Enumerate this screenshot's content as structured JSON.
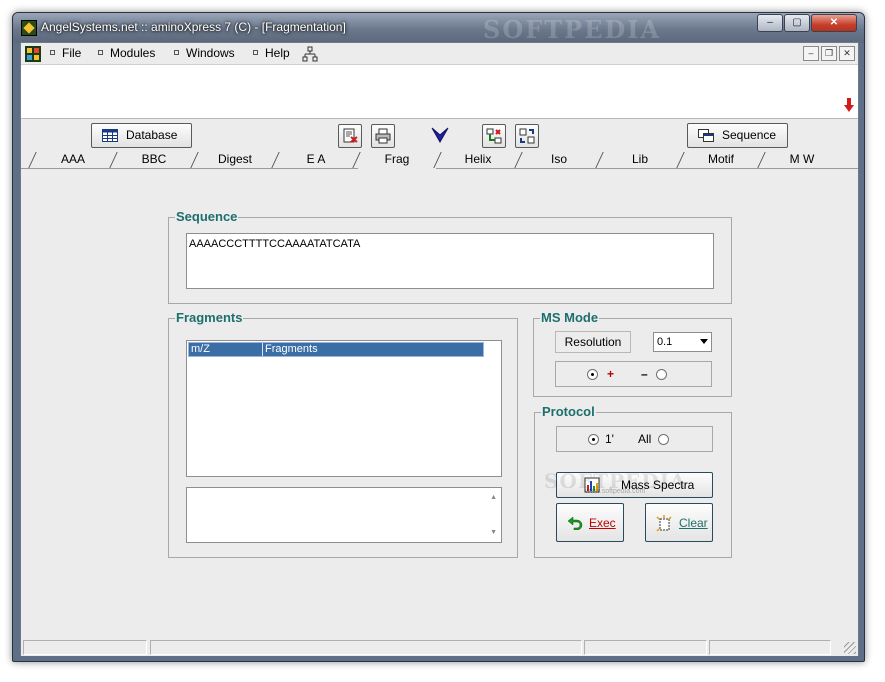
{
  "window": {
    "title": "AngelSystems.net :: aminoXpress 7 (C) - [Fragmentation]",
    "watermark": "SOFTPEDIA",
    "caption_buttons": {
      "minimize": "–",
      "maximize": "▢",
      "close": "✕"
    }
  },
  "menu": {
    "items": [
      {
        "label": "File"
      },
      {
        "label": "Modules"
      },
      {
        "label": "Windows"
      },
      {
        "label": "Help"
      }
    ],
    "mdi_buttons": {
      "minimize": "–",
      "restore": "❐",
      "close": "✕"
    }
  },
  "toolbar": {
    "database_label": "Database",
    "sequence_label": "Sequence",
    "icons": [
      "export-icon",
      "print-icon",
      "checkmark-icon",
      "structure-icon",
      "swap-icon"
    ]
  },
  "tabs": {
    "items": [
      "AAA",
      "BBC",
      "Digest",
      "E A",
      "Frag",
      "Helix",
      "Iso",
      "Lib",
      "Motif",
      "M W"
    ],
    "active": "Frag"
  },
  "sequence": {
    "label": "Sequence",
    "value": "AAAACCCTTTTCCAAAATATCATA"
  },
  "fragments": {
    "label": "Fragments",
    "columns": [
      "m/Z",
      "Fragments"
    ],
    "rows": []
  },
  "ms_mode": {
    "label": "MS Mode",
    "resolution_label": "Resolution",
    "resolution_value": "0.1",
    "plus_label": "+",
    "minus_label": "–",
    "selected": "plus"
  },
  "protocol": {
    "label": "Protocol",
    "option1_label": "1'",
    "option2_label": "All",
    "selected": "1'",
    "mass_spectra_label": "Mass Spectra",
    "exec_label": "Exec",
    "clear_label": "Clear",
    "overlay_watermark": "SOFTPEDIA",
    "overlay_url": "www.softpedia.com"
  },
  "colors": {
    "group_label": "#1d6f6d",
    "exec_text": "#c00000",
    "clear_text": "#1d6f6d",
    "list_header_bg": "#3a6ea5",
    "plus_sign": "#c00000"
  }
}
